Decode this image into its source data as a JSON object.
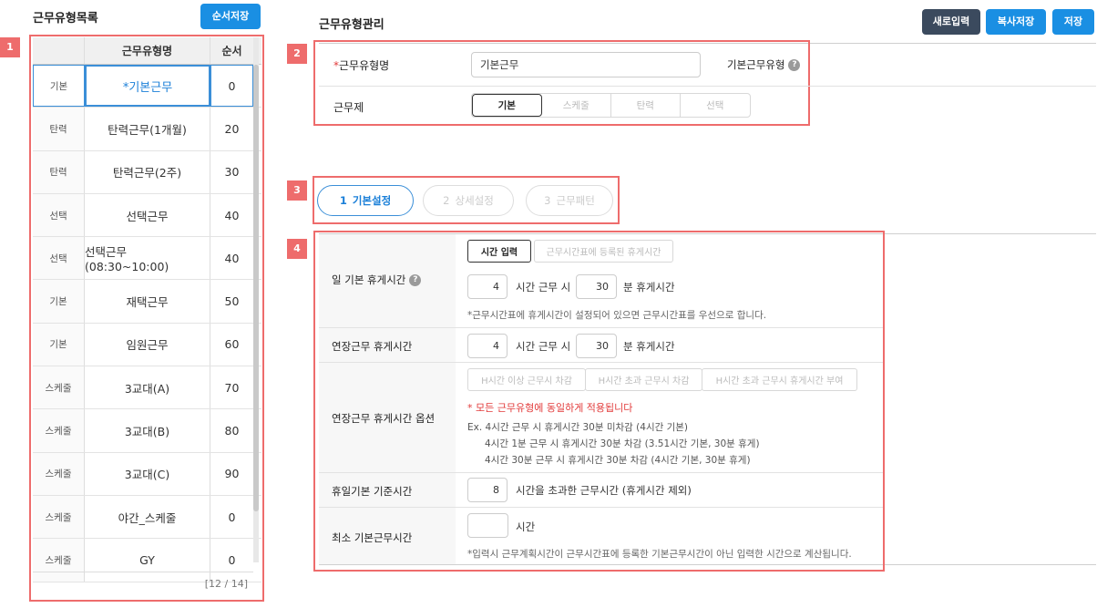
{
  "left": {
    "title": "근무유형목록",
    "order_save": "순서저장",
    "marker": "1",
    "headers": {
      "type": "",
      "name": "근무유형명",
      "order": "순서"
    },
    "rows": [
      {
        "type": "기본",
        "name": "*기본근무",
        "order": "0"
      },
      {
        "type": "탄력",
        "name": "탄력근무(1개월)",
        "order": "20"
      },
      {
        "type": "탄력",
        "name": "탄력근무(2주)",
        "order": "30"
      },
      {
        "type": "선택",
        "name": "선택근무",
        "order": "40"
      },
      {
        "type": "선택",
        "name": "선택근무(08:30~10:00)",
        "order": "40"
      },
      {
        "type": "기본",
        "name": "재택근무",
        "order": "50"
      },
      {
        "type": "기본",
        "name": "임원근무",
        "order": "60"
      },
      {
        "type": "스케줄",
        "name": "3교대(A)",
        "order": "70"
      },
      {
        "type": "스케줄",
        "name": "3교대(B)",
        "order": "80"
      },
      {
        "type": "스케줄",
        "name": "3교대(C)",
        "order": "90"
      },
      {
        "type": "스케줄",
        "name": "야간_스케줄",
        "order": "0"
      },
      {
        "type": "스케줄",
        "name": "GY",
        "order": "0"
      }
    ],
    "pager": "[12 / 14]"
  },
  "right": {
    "title": "근무유형관리",
    "btn_new": "새로입력",
    "btn_copy": "복사저장",
    "btn_save": "저장"
  },
  "section2": {
    "marker": "2",
    "name_label_req": "*",
    "name_label": "근무유형명",
    "name_value": "기본근무",
    "base_type_label": "기본근무유형",
    "help": "?",
    "work_label": "근무제",
    "work_options": [
      "기본",
      "스케줄",
      "탄력",
      "선택"
    ]
  },
  "section3": {
    "marker": "3",
    "steps": [
      {
        "num": "1",
        "label": "기본설정"
      },
      {
        "num": "2",
        "label": "상세설정"
      },
      {
        "num": "3",
        "label": "근무패턴"
      }
    ]
  },
  "section4": {
    "marker": "4",
    "daily_break_label": "일 기본 휴게시간",
    "tab_time_input": "시간 입력",
    "tab_schedule_break": "근무시간표에 등록된 휴게시간",
    "daily_hours": "4",
    "daily_minutes": "30",
    "hours_work_text": "시간 근무 시",
    "minutes_break_text": "분 휴게시간",
    "daily_note": "*근무시간표에 휴게시간이 설정되어 있으면 근무시간표를 우선으로 합니다.",
    "overtime_break_label": "연장근무 휴게시간",
    "ot_hours": "4",
    "ot_minutes": "30",
    "ot_option_label": "연장근무 휴게시간 옵션",
    "ot_opt1": "H시간 이상 근무시 차감",
    "ot_opt2": "H시간 초과 근무시 차감",
    "ot_opt3": "H시간 초과 근무시 휴게시간 부여",
    "ot_warn": "* 모든 근무유형에 동일하게 적용됩니다",
    "ot_ex1": "Ex. 4시간 근무 시 휴게시간 30분 미차감 (4시간 기본)",
    "ot_ex2": "4시간 1분 근무 시 휴게시간 30분 차감 (3.51시간 기본, 30분 휴게)",
    "ot_ex3": "4시간 30분 근무 시 휴게시간 30분 차감 (4시간 기본, 30분 휴게)",
    "holiday_label": "휴일기본 기준시간",
    "holiday_hours": "8",
    "holiday_text": "시간을 초과한 근무시간 (휴게시간 제외)",
    "min_label": "최소 기본근무시간",
    "min_hours": "",
    "min_text": "시간",
    "min_note": "*입력시 근무계획시간이 근무시간표에 등록한 기본근무시간이 아닌 입력한 시간으로 계산됩니다."
  }
}
